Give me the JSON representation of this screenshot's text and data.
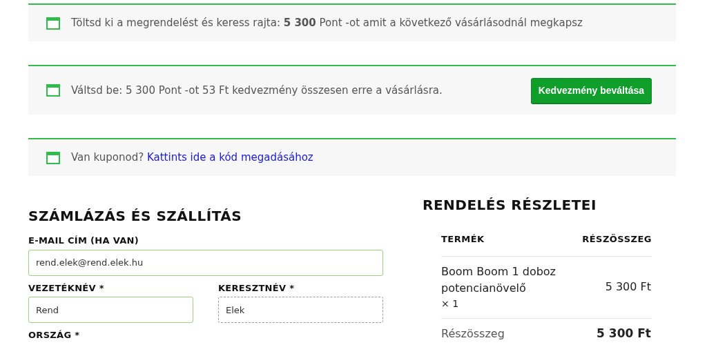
{
  "notices": [
    {
      "text": "Töltsd ki a megrendelést és keress rajta: **5 300** Pont -ot amit a következő vásárlásodnál megkapsz"
    },
    {
      "text": "Váltsd be: 5 300 Pont -ot 53 Ft kedvezmény összesen erre a vásárlásra.",
      "button": "Kedvezmény beváltása"
    },
    {
      "text": "Van kuponod?",
      "link": "Kattints ide a kód megadásához"
    }
  ],
  "billing": {
    "title": "SZÁMLÁZÁS ÉS SZÁLLÍTÁS",
    "fields": [
      {
        "label": "E-MAIL CÍM (HA VAN)",
        "value": "rend.elek@rend.elek.hu",
        "valid": true,
        "kind": "full"
      },
      {
        "label": "VEZETÉKNÉV *",
        "value": "Rend",
        "valid": true,
        "kind": "half"
      },
      {
        "label": "KERESZTNÉV *",
        "value": "Elek",
        "valid": false,
        "kind": "half"
      },
      {
        "label": "ORSZÁG *",
        "kind": "full"
      }
    ]
  },
  "order": {
    "title": "RENDELÉS RÉSZLETEI",
    "columns": [
      "TERMÉK",
      "RÉSZÖSSZEG"
    ],
    "items": [
      {
        "name": "Boom Boom 1 doboz potencianövelő",
        "quantity": "× 1",
        "total": "5 300 Ft"
      }
    ],
    "subtotal": {
      "label": "Részösszeg",
      "value": "5 300 Ft"
    }
  }
}
